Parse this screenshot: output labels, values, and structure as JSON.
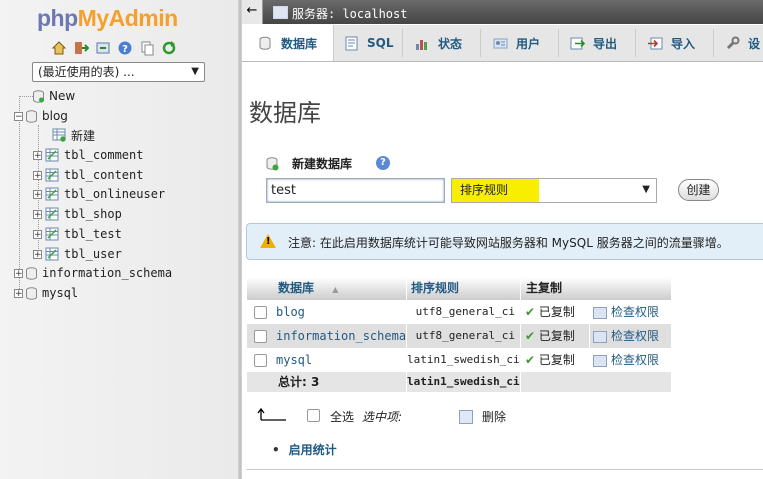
{
  "nav": {
    "logo_part1": "php",
    "logo_part2": "MyAdmin",
    "icons": [
      "home-icon",
      "logout-icon",
      "query-window-icon",
      "docs-icon",
      "copy-icon",
      "reload-icon"
    ],
    "recent_select": "(最近使用的表) ...",
    "tree": {
      "new_label": "New",
      "blog": "blog",
      "blog_new": "新建",
      "tables": [
        "tbl_comment",
        "tbl_content",
        "tbl_onlineuser",
        "tbl_shop",
        "tbl_test",
        "tbl_user"
      ],
      "information_schema": "information_schema",
      "mysql": "mysql"
    }
  },
  "topbar": {
    "collapse": "←",
    "server_label": "服务器: localhost"
  },
  "tabs": [
    {
      "label": "数据库",
      "icon": "database-icon",
      "active": true
    },
    {
      "label": "SQL",
      "icon": "sql-icon"
    },
    {
      "label": "状态",
      "icon": "status-icon"
    },
    {
      "label": "用户",
      "icon": "users-icon"
    },
    {
      "label": "导出",
      "icon": "export-icon"
    },
    {
      "label": "导入",
      "icon": "import-icon"
    },
    {
      "label": "设",
      "icon": "settings-icon"
    }
  ],
  "main": {
    "title": "数据库",
    "create": {
      "label": "新建数据库",
      "help": "?",
      "name_value": "test",
      "collation_value": "排序规则",
      "button": "创建"
    },
    "notice": "注意: 在此启用数据库统计可能导致网站服务器和 MySQL 服务器之间的流量骤增。",
    "table": {
      "headers": {
        "database": "数据库",
        "sort_indicator": "▲",
        "collation": "排序规则",
        "replication": "主复制"
      },
      "rows": [
        {
          "name": "blog",
          "collation": "utf8_general_ci",
          "replication": "已复制",
          "privileges": "检查权限"
        },
        {
          "name": "information_schema",
          "collation": "utf8_general_ci",
          "replication": "已复制",
          "privileges": "检查权限"
        },
        {
          "name": "mysql",
          "collation": "latin1_swedish_ci",
          "replication": "已复制",
          "privileges": "检查权限"
        }
      ],
      "total_label": "总计: 3",
      "total_collation": "latin1_swedish_ci",
      "check_mark": "✔"
    },
    "footer": {
      "check_all": "全选",
      "with_selected": "选中项:",
      "drop": "删除",
      "enable_stats": "启用统计"
    }
  },
  "colors": {
    "link": "#235a81",
    "highlight": "#f7ee00",
    "notice_bg": "#e3eff8",
    "logo_php": "#6c78af",
    "logo_myadmin": "#f6a02c"
  }
}
